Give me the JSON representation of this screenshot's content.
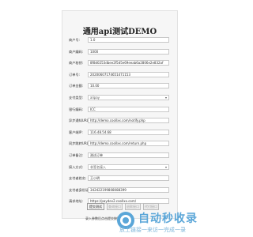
{
  "page": {
    "title": "通用api测试DEMO",
    "footer_hint": "录入参数后点击提交按钮"
  },
  "fields": [
    {
      "label": "商户号:",
      "value": "1.0",
      "type": "input"
    },
    {
      "label": "商户编码:",
      "value": "1000",
      "type": "input"
    },
    {
      "label": "商户秘钥:",
      "value": "8f8d0253dbee2f5d5e69eeab6a2806e2e832af",
      "type": "input"
    },
    {
      "label": "订单号:",
      "value": "20200607174651471153",
      "type": "input"
    },
    {
      "label": "订单金额:",
      "value": "10.00",
      "type": "input"
    },
    {
      "label": "支付类型:",
      "value": "alipay",
      "type": "select"
    },
    {
      "label": "银行编码:",
      "value": "ICC",
      "type": "input"
    },
    {
      "label": "异步通知URL:",
      "value": "http://demo.coollxx.com/notify.php",
      "type": "input"
    },
    {
      "label": "客户端IP:",
      "value": "116.48.54.68",
      "type": "input"
    },
    {
      "label": "同步跳转URL:",
      "value": "http://demo.coollxx.com/return.php",
      "type": "input"
    },
    {
      "label": "订单备注:",
      "value": "测试订单",
      "type": "input"
    },
    {
      "label": "接入方式:",
      "value": "非签名接入",
      "type": "select"
    },
    {
      "label": "支付者姓名:",
      "value": "王小明",
      "type": "input"
    },
    {
      "label": "支付者身份证:",
      "value": "342422199808088399",
      "type": "input"
    },
    {
      "label": "请求地址:",
      "value": "https://paydev2.coollxx.com/",
      "type": "input"
    }
  ],
  "buttons": [
    {
      "label": "提交测试",
      "primary": true
    },
    {
      "label": "查询接口",
      "primary": false
    },
    {
      "label": "退款接口",
      "primary": false
    },
    {
      "label": "代付接口",
      "primary": false
    }
  ],
  "watermark": {
    "title": "自动秒收录",
    "subtitle": "放上链接一来访一完成一录",
    "color": "#5aa6d8"
  }
}
